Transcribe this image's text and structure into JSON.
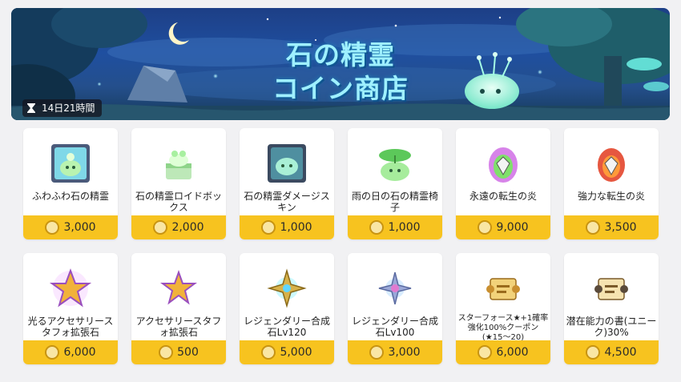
{
  "banner": {
    "title_line1": "石の精霊",
    "title_line2": "コイン商店",
    "timer_text": "14日21時間"
  },
  "items": [
    {
      "name": "ふわふわ石の精霊",
      "price": "3,000",
      "icon": "fluffy-stone-spirit-icon"
    },
    {
      "name": "石の精霊ロイドボックス",
      "price": "2,000",
      "icon": "stone-spirit-android-box-icon"
    },
    {
      "name": "石の精霊ダメージスキン",
      "price": "1,000",
      "icon": "stone-spirit-damage-skin-icon"
    },
    {
      "name": "雨の日の石の精霊椅子",
      "price": "1,000",
      "icon": "rainy-day-spirit-chair-icon"
    },
    {
      "name": "永遠の転生の炎",
      "price": "9,000",
      "icon": "eternal-rebirth-flame-icon"
    },
    {
      "name": "強力な転生の炎",
      "price": "3,500",
      "icon": "powerful-rebirth-flame-icon"
    },
    {
      "name": "光るアクセサリースタフォ拡張石",
      "price": "6,000",
      "icon": "shining-star-stone-icon"
    },
    {
      "name": "アクセサリースタフォ拡張石",
      "price": "500",
      "icon": "star-stone-icon"
    },
    {
      "name": "レジェンダリー合成石Lv120",
      "price": "5,000",
      "icon": "legendary-stone-lv120-icon"
    },
    {
      "name": "レジェンダリー合成石Lv100",
      "price": "3,000",
      "icon": "legendary-stone-lv100-icon"
    },
    {
      "name": "スターフォース★+1確率強化100%クーポン(★15～20)",
      "price": "6,000",
      "icon": "starforce-coupon-scroll-icon"
    },
    {
      "name": "潜在能力の書(ユニーク)30%",
      "price": "4,500",
      "icon": "potential-scroll-icon"
    }
  ],
  "colors": {
    "price_bar": "#f7c31f",
    "page_bg": "#f1f1f3",
    "title_text": "#9ff0ff"
  }
}
